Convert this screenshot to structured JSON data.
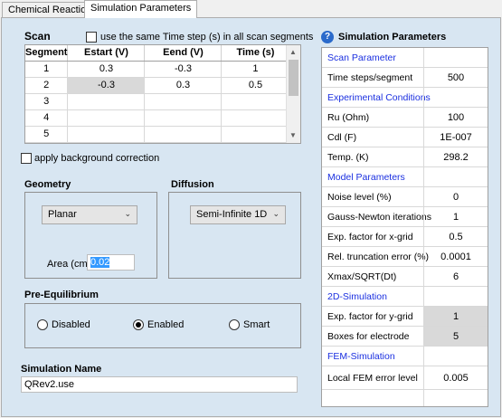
{
  "tabs": [
    {
      "label": "Chemical Reactions",
      "active": false
    },
    {
      "label": "Simulation Parameters",
      "active": true
    }
  ],
  "scan": {
    "title": "Scan",
    "same_time_step_label": "use the same Time step (s) in all scan segments",
    "columns": [
      "Segment",
      "Estart (V)",
      "Eend (V)",
      "Time (s)"
    ],
    "rows": [
      [
        "1",
        "0.3",
        "-0.3",
        "1"
      ],
      [
        "2",
        "-0.3",
        "0.3",
        "0.5"
      ],
      [
        "3",
        "",
        "",
        ""
      ],
      [
        "4",
        "",
        "",
        ""
      ],
      [
        "5",
        "",
        "",
        ""
      ]
    ],
    "background_correction_label": "apply background correction"
  },
  "geometry": {
    "title": "Geometry",
    "selected": "Planar",
    "area_label": "Area (cm²)",
    "area_value": "0.02"
  },
  "diffusion": {
    "title": "Diffusion",
    "selected": "Semi-Infinite 1D"
  },
  "pre_equilibrium": {
    "title": "Pre-Equilibrium",
    "options": [
      "Disabled",
      "Enabled",
      "Smart"
    ],
    "selected": "Enabled"
  },
  "simulation_name": {
    "title": "Simulation Name",
    "value": "QRev2.use"
  },
  "sim_params": {
    "title": "Simulation Parameters",
    "rows": [
      {
        "label": "Scan Parameter",
        "value": "",
        "header": true
      },
      {
        "label": "Time steps/segment",
        "value": "500"
      },
      {
        "label": "Experimental Conditions",
        "value": "",
        "header": true
      },
      {
        "label": "Ru (Ohm)",
        "value": "100"
      },
      {
        "label": "Cdl (F)",
        "value": "1E-007"
      },
      {
        "label": "Temp. (K)",
        "value": "298.2"
      },
      {
        "label": "Model Parameters",
        "value": "",
        "header": true
      },
      {
        "label": "Noise level (%)",
        "value": "0"
      },
      {
        "label": "Gauss-Newton iterations",
        "value": "1"
      },
      {
        "label": "Exp. factor for x-grid",
        "value": "0.5"
      },
      {
        "label": "Rel. truncation error (%)",
        "value": "0.0001"
      },
      {
        "label": "Xmax/SQRT(Dt)",
        "value": "6"
      },
      {
        "label": "2D-Simulation",
        "value": "",
        "header": true
      },
      {
        "label": "Exp. factor for y-grid",
        "value": "1",
        "grey": true
      },
      {
        "label": "Boxes for electrode",
        "value": "5",
        "grey": true
      },
      {
        "label": "FEM-Simulation",
        "value": "",
        "header": true
      },
      {
        "label": "Local FEM error level",
        "value": "0.005"
      },
      {
        "label": "",
        "value": ""
      }
    ]
  }
}
